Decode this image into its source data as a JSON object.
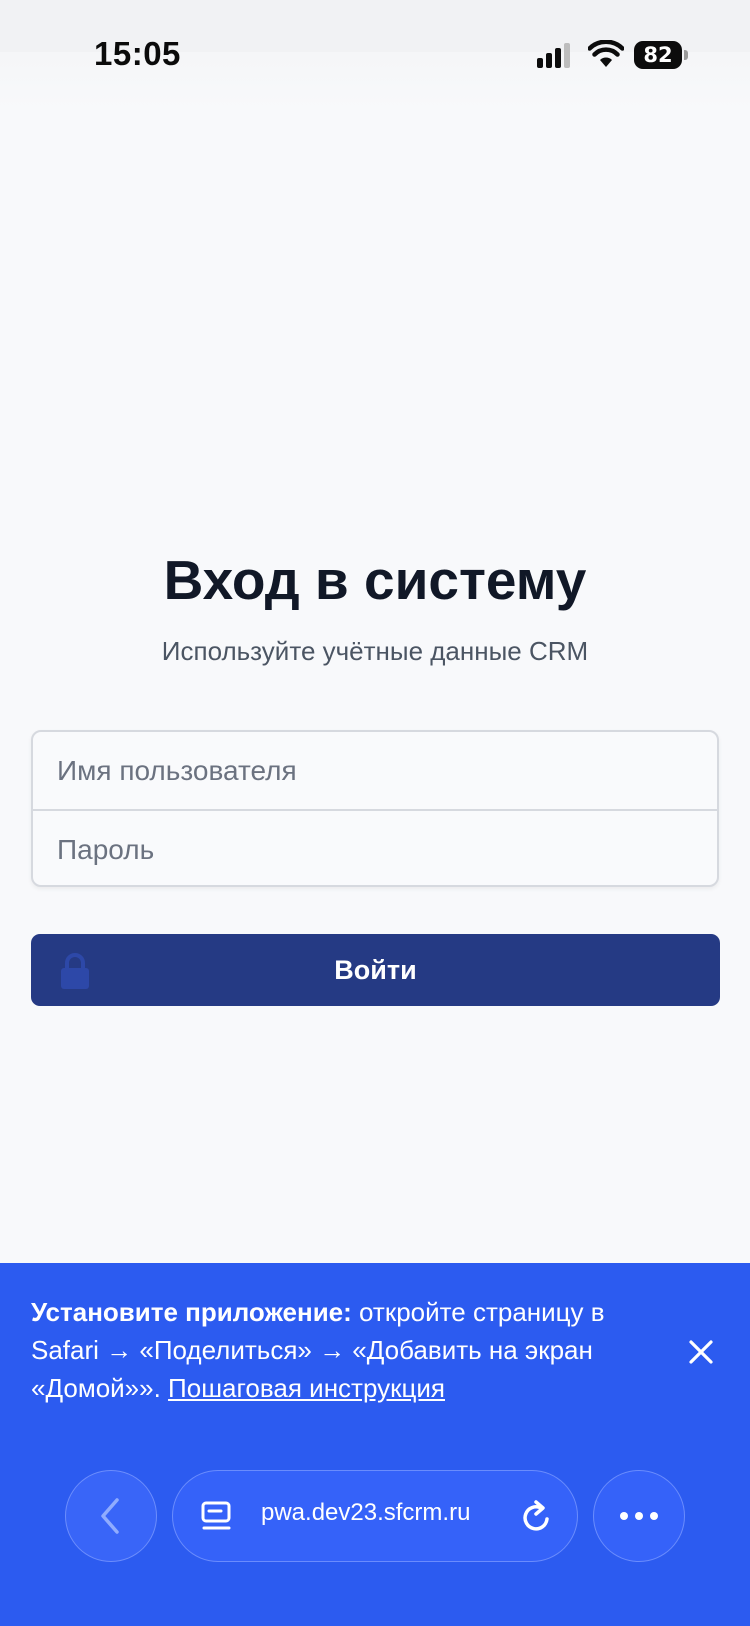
{
  "status_bar": {
    "time": "15:05",
    "battery": "82",
    "icons": [
      "signal-icon",
      "wifi-icon",
      "battery-icon"
    ]
  },
  "login": {
    "title": "Вход в систему",
    "subtitle": "Используйте учётные данные CRM",
    "username_placeholder": "Имя пользователя",
    "username_value": "",
    "password_placeholder": "Пароль",
    "password_value": "",
    "submit_label": "Войти",
    "submit_icon": "lock-icon"
  },
  "install_banner": {
    "bold": "Установите приложение:",
    "text": " откройте страницу в Safari → «Поделиться» → «Добавить на экран «Домой»». ",
    "link": "Пошаговая инструкция",
    "close_icon": "close-icon"
  },
  "browser": {
    "url": "pwa.dev23.sfcrm.ru",
    "icons": [
      "back-icon",
      "tab-icon",
      "reload-icon",
      "more-icon"
    ]
  },
  "colors": {
    "background": "#f8f9fb",
    "primary_button": "#253a84",
    "banner": "#2c5bf0",
    "title": "#111827"
  }
}
